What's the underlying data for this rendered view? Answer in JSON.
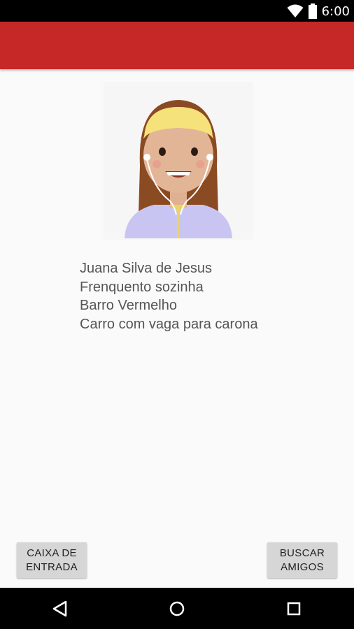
{
  "status_bar": {
    "time": "6:00",
    "icons": [
      "wifi-icon",
      "battery-icon"
    ]
  },
  "app_bar": {
    "color": "#c62828"
  },
  "avatar": {
    "icon": "girl-with-earphones-avatar"
  },
  "profile": {
    "name": "Juana Silva de Jesus",
    "attendance": "Frenquento sozinha",
    "neighborhood": "Barro Vermelho",
    "ride": "Carro com vaga para carona"
  },
  "buttons": {
    "inbox_label": "CAIXA DE\nENTRADA",
    "find_friends_label": "BUSCAR\nAMIGOS"
  },
  "nav_bar": {
    "icons": [
      "back-icon",
      "home-icon",
      "recents-icon"
    ]
  }
}
